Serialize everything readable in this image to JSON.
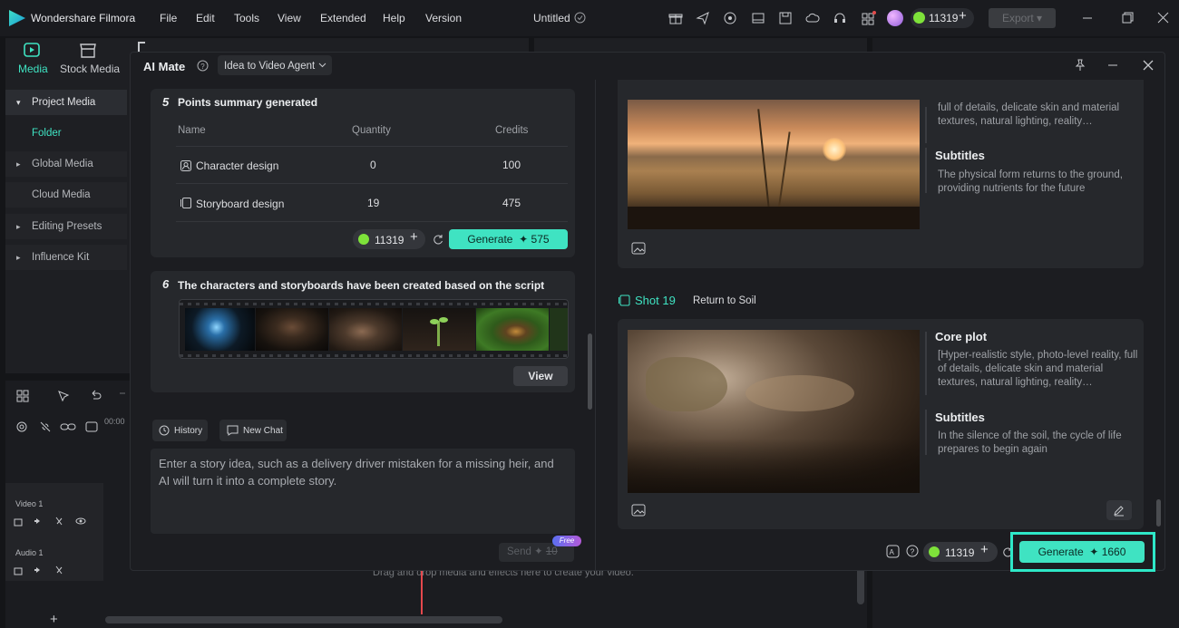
{
  "app": {
    "name": "Wondershare Filmora",
    "menu": [
      "File",
      "Edit",
      "Tools",
      "View",
      "Extended",
      "Help",
      "Version"
    ],
    "document_title": "Untitled",
    "credits": "11319",
    "export_label": "Export"
  },
  "left_tabs": {
    "media": "Media",
    "stock_media": "Stock Media"
  },
  "sidebar": {
    "items": [
      {
        "label": "Project Media",
        "caret": "▾"
      },
      {
        "label": "Folder",
        "caret": ""
      },
      {
        "label": "Global Media",
        "caret": "▸"
      },
      {
        "label": "Cloud Media",
        "caret": ""
      },
      {
        "label": "Editing Presets",
        "caret": "▸"
      },
      {
        "label": "Influence Kit",
        "caret": "▸"
      }
    ]
  },
  "timeline": {
    "time": "00:00",
    "video_track": "Video 1",
    "audio_track": "Audio 1",
    "drop_hint": "Drag and drop media and effects here to create your video."
  },
  "modal": {
    "title": "AI Mate",
    "mode": "Idea to Video Agent",
    "step5": {
      "number": "5",
      "title": "Points summary generated",
      "columns": [
        "Name",
        "Quantity",
        "Credits"
      ],
      "rows": [
        {
          "name": "Character design",
          "quantity": "0",
          "credits": "100"
        },
        {
          "name": "Storyboard design",
          "quantity": "19",
          "credits": "475"
        }
      ],
      "credits": "11319",
      "generate_label": "Generate",
      "generate_cost": "575"
    },
    "step6": {
      "number": "6",
      "title": "The characters and storyboards have been created based on the script",
      "view_label": "View"
    },
    "history_label": "History",
    "new_chat_label": "New Chat",
    "input_placeholder": "Enter a story idea, such as a delivery driver mistaken for a missing heir, and AI will turn it into a complete story.",
    "send_label": "Send",
    "send_cost": "10",
    "free_badge": "Free",
    "shot18": {
      "plot_text": "full of details, delicate skin and material textures, natural lighting, reality…",
      "subtitles_heading": "Subtitles",
      "subtitles_text": "The physical form returns to the ground, providing nutrients for the future"
    },
    "shot19": {
      "label": "Shot 19",
      "title": "Return to Soil",
      "plot_heading": "Core plot",
      "plot_text": "[Hyper-realistic style, photo-level reality, full of details, delicate skin and material textures, natural lighting, reality…",
      "subtitles_heading": "Subtitles",
      "subtitles_text": "In the silence of the soil, the cycle of life prepares to begin again"
    },
    "bottom_credits": "11319",
    "bottom_generate_label": "Generate",
    "bottom_generate_cost": "1660"
  },
  "colors": {
    "accent": "#3fe3c2",
    "highlight_border": "#2ee8c8",
    "background": "#141518"
  }
}
